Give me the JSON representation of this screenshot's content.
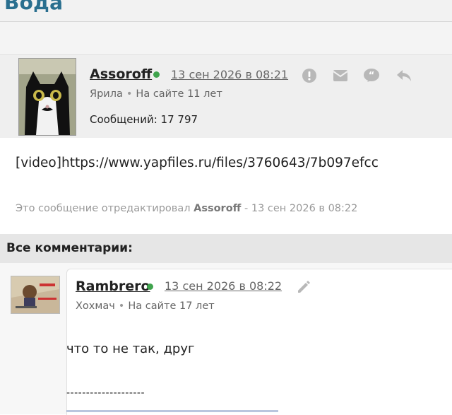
{
  "topic": {
    "title": "Вода"
  },
  "post": {
    "author": "Assoroff",
    "date": "13 сен 2026 в 08:21",
    "rank": "Ярила",
    "tenure": "На сайте 11 лет",
    "messages": "Сообщений: 17 797",
    "body": "[video]https://www.yapfiles.ru/files/3760643/7b097efcc",
    "edited_prefix": "Это сообщение отредактировал",
    "edited_by": "Assoroff",
    "edited_suffix": "- 13 сен 2026 в 08:22",
    "actions": [
      {
        "icon": "report-icon"
      },
      {
        "icon": "message-icon"
      },
      {
        "icon": "quote-icon"
      },
      {
        "icon": "reply-icon"
      }
    ],
    "online_color": "#3fa34d"
  },
  "comments": {
    "header": "Все комментарии:",
    "items": [
      {
        "author": "Rambrero",
        "date": "13 сен 2026 в 08:22",
        "rank": "Хохмач",
        "tenure": "На сайте 17 лет",
        "text": "что то не так, друг",
        "signature_line": "--------------------",
        "edit_icon": "pencil-icon"
      }
    ]
  }
}
